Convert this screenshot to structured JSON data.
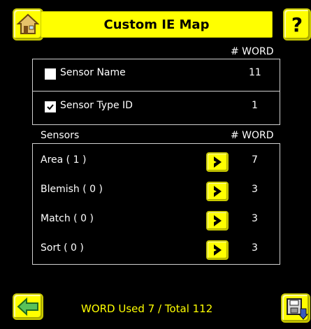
{
  "header": {
    "title": "Custom IE Map"
  },
  "top_section": {
    "word_header": "# WORD",
    "rows": [
      {
        "label": "Sensor Name",
        "checked": false,
        "word": "11"
      },
      {
        "label": "Sensor Type ID",
        "checked": true,
        "word": "1"
      }
    ]
  },
  "sensors_section": {
    "header_left": "Sensors",
    "header_right": "# WORD",
    "rows": [
      {
        "label": "Area ( 1 )",
        "word": "7"
      },
      {
        "label": "Blemish ( 0 )",
        "word": "3"
      },
      {
        "label": "Match ( 0 )",
        "word": "3"
      },
      {
        "label": "Sort ( 0 )",
        "word": "3"
      }
    ]
  },
  "footer": {
    "status": "WORD Used 7 / Total 112"
  },
  "icons": {
    "home": "home-icon",
    "help": "help-icon",
    "back": "back-arrow-icon",
    "save": "save-disk-icon",
    "go": "chevron-right-icon",
    "check": "check-icon"
  },
  "colors": {
    "accent": "#ffff00",
    "background": "#000000",
    "panel_border": "#d0d0d0"
  }
}
